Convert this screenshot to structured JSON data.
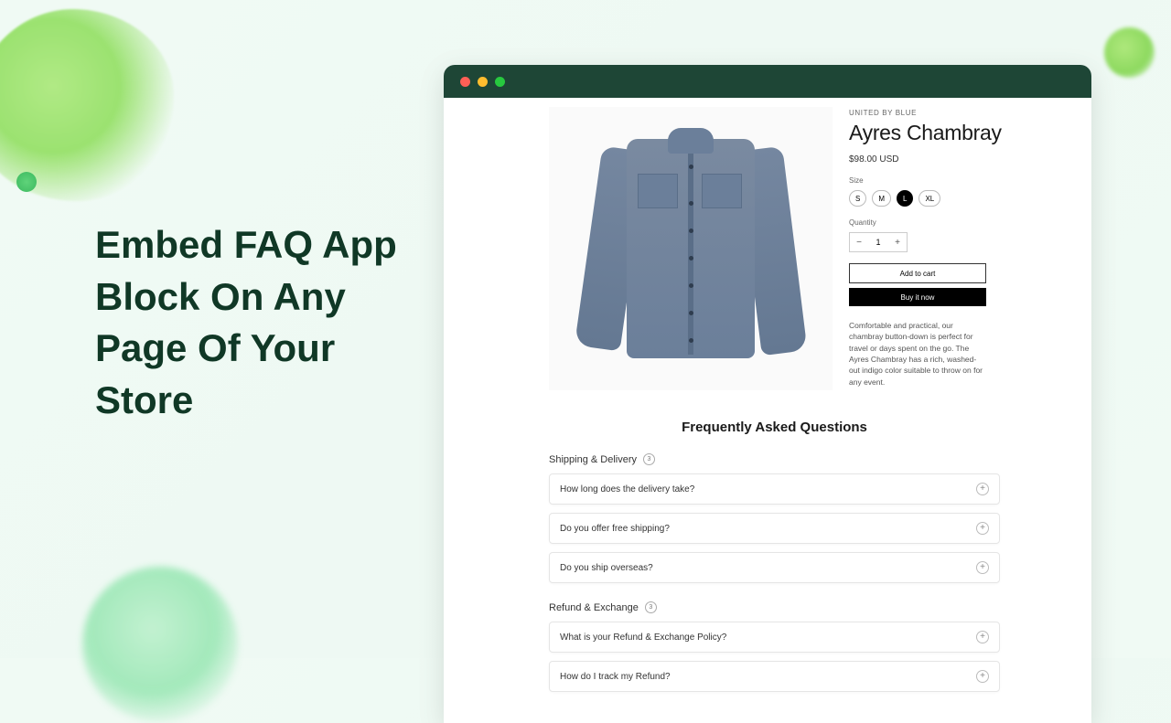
{
  "headline": "Embed FAQ App Block On Any Page Of Your Store",
  "product": {
    "brand": "UNITED BY BLUE",
    "title": "Ayres Chambray",
    "price": "$98.00 USD",
    "size_label": "Size",
    "sizes": [
      "S",
      "M",
      "L",
      "XL"
    ],
    "selected_size": "L",
    "qty_label": "Quantity",
    "quantity": "1",
    "add_to_cart": "Add to cart",
    "buy_now": "Buy it now",
    "description": "Comfortable and practical, our chambray button-down is perfect for travel or days spent on the go. The Ayres Chambray has a rich, washed-out indigo color suitable to throw on for any event."
  },
  "faq": {
    "title": "Frequently Asked Questions",
    "categories": [
      {
        "name": "Shipping & Delivery",
        "count": "3",
        "items": [
          "How long does the delivery take?",
          "Do you offer free shipping?",
          "Do you ship overseas?"
        ]
      },
      {
        "name": "Refund & Exchange",
        "count": "3",
        "items": [
          "What is your Refund & Exchange Policy?",
          "How do I track my Refund?"
        ]
      }
    ]
  }
}
